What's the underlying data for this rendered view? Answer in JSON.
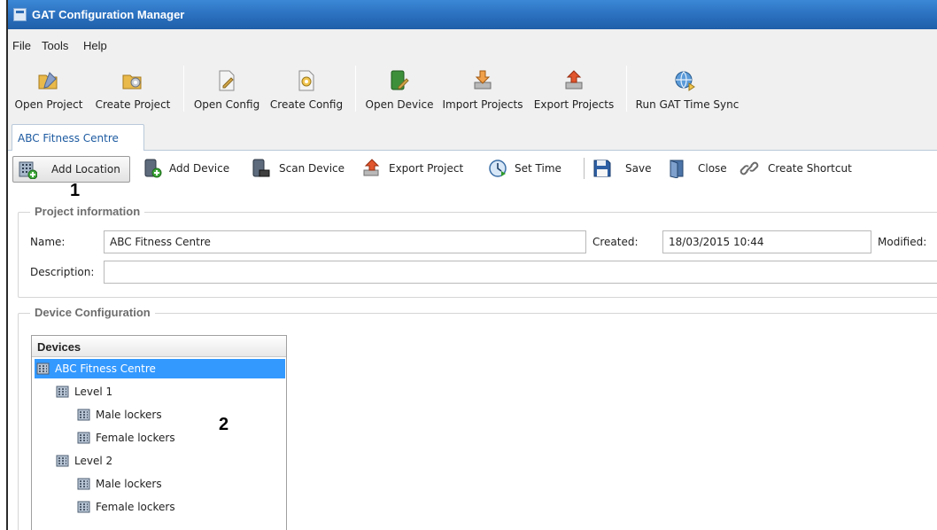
{
  "window": {
    "title": "GAT Configuration Manager"
  },
  "menu": [
    "File",
    "Tools",
    "Help"
  ],
  "toolbar": [
    {
      "label": "Open Project",
      "icon": "folder-open-icon"
    },
    {
      "label": "Create Project",
      "icon": "folder-gear-icon"
    },
    {
      "label": "Open Config",
      "icon": "document-edit-icon"
    },
    {
      "label": "Create Config",
      "icon": "document-gear-icon"
    },
    {
      "label": "Open Device",
      "icon": "device-edit-icon"
    },
    {
      "label": "Import Projects",
      "icon": "import-arrow-icon"
    },
    {
      "label": "Export Projects",
      "icon": "export-arrow-icon"
    },
    {
      "label": "Run GAT Time Sync",
      "icon": "globe-sync-icon"
    }
  ],
  "tab": {
    "label": "ABC Fitness Centre"
  },
  "actions": [
    {
      "label": "Add Location",
      "icon": "building-add-icon"
    },
    {
      "label": "Add Device",
      "icon": "device-add-icon"
    },
    {
      "label": "Scan Device",
      "icon": "device-scan-icon"
    },
    {
      "label": "Export Project",
      "icon": "export-arrow-icon"
    },
    {
      "label": "Set Time",
      "icon": "clock-sync-icon"
    },
    {
      "label": "Save",
      "icon": "floppy-disk-icon"
    },
    {
      "label": "Close",
      "icon": "door-close-icon"
    },
    {
      "label": "Create Shortcut",
      "icon": "link-chain-icon"
    }
  ],
  "annotations": {
    "one": "1",
    "two": "2"
  },
  "project_info": {
    "title": "Project information",
    "name_label": "Name:",
    "name_value": "ABC Fitness Centre",
    "created_label": "Created:",
    "created_value": "18/03/2015 10:44",
    "modified_label": "Modified:",
    "description_label": "Description:",
    "description_value": ""
  },
  "device_config": {
    "title": "Device Configuration",
    "tree_header": "Devices",
    "nodes": [
      {
        "label": "ABC Fitness Centre",
        "level": 0,
        "selected": true
      },
      {
        "label": "Level 1",
        "level": 1
      },
      {
        "label": "Male lockers",
        "level": 2
      },
      {
        "label": "Female lockers",
        "level": 2
      },
      {
        "label": "Level 2",
        "level": 1
      },
      {
        "label": "Male lockers",
        "level": 2
      },
      {
        "label": "Female lockers",
        "level": 2
      }
    ]
  },
  "colors": {
    "titlebar": "#2b71c0",
    "selection": "#3399ff",
    "tab_text": "#1c5aa0"
  }
}
